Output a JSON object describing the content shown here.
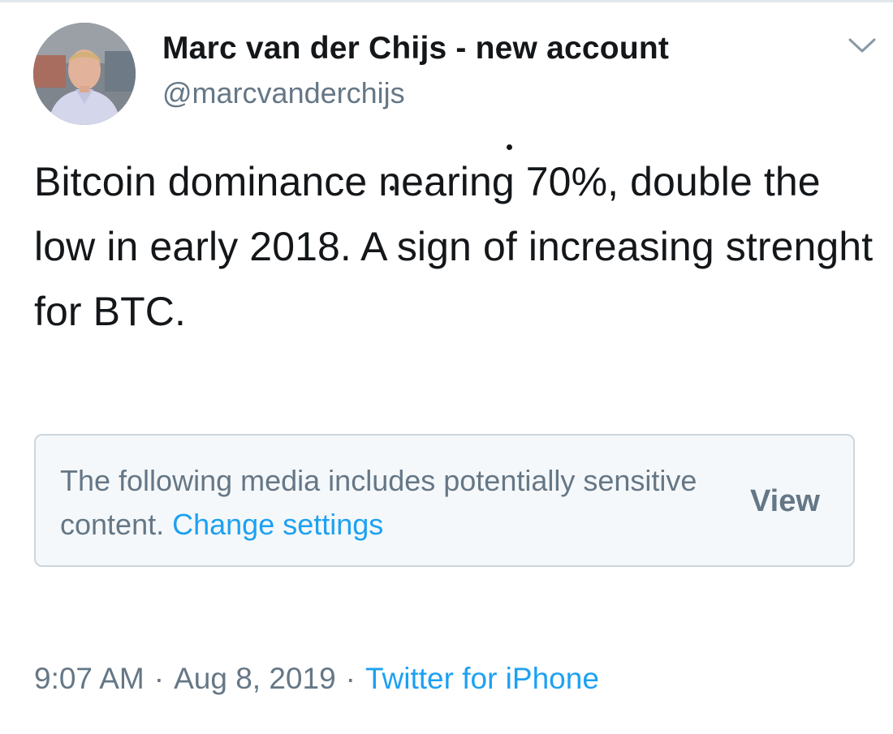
{
  "author": {
    "display_name": "Marc van der Chijs - new account",
    "handle": "@marcvanderchijs"
  },
  "icons": {
    "more": "chevron-down-icon",
    "avatar": "profile-photo"
  },
  "tweet": {
    "text": "Bitcoin dominance nearing 70%, double the low in early 2018. A sign of increasing strenght for BTC."
  },
  "sensitive_notice": {
    "message": "The following media includes potentially sensitive content.",
    "link_label": "Change settings",
    "view_label": "View"
  },
  "meta": {
    "time": "9:07 AM",
    "separator": "·",
    "date": "Aug 8, 2019",
    "source": "Twitter for iPhone"
  },
  "colors": {
    "text": "#14171a",
    "secondary": "#657786",
    "link": "#1da1f2",
    "notice_bg": "#f5f8fa",
    "notice_border": "#ccd6dd"
  }
}
